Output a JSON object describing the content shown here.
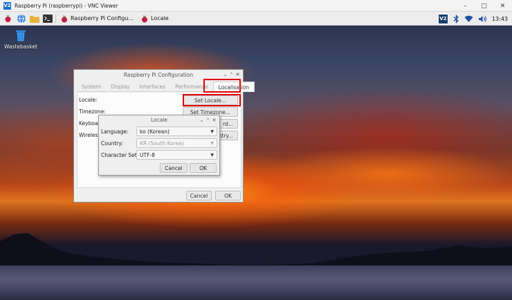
{
  "vnc": {
    "logo": "V2",
    "title": "Raspberry Pi (raspberrypi) - VNC Viewer",
    "controls": [
      "–",
      "□",
      "✕"
    ]
  },
  "taskbar": {
    "task_config": "Raspberry Pi Configu...",
    "task_locale": "Locale",
    "tray_vnc": "V2",
    "clock": "13:43"
  },
  "desktop": {
    "wastebasket_label": "Wastebasket"
  },
  "config_dialog": {
    "title": "Raspberry Pi Configuration",
    "title_controls": [
      "⌄",
      "⌃",
      "✕"
    ],
    "tabs": [
      "System",
      "Display",
      "Interfaces",
      "Performance",
      "Localisation"
    ],
    "active_tab": "Localisation",
    "rows": {
      "locale": "Locale:",
      "timezone": "Timezone:",
      "keyboard": "Keyboard",
      "wireless": "Wireless"
    },
    "buttons": {
      "set_locale": "Set Locale...",
      "set_timezone": "Set Timezone...",
      "keyboard_partial": "rd...",
      "country_partial": "ountry..."
    },
    "cancel": "Cancel",
    "ok": "OK"
  },
  "locale_dialog": {
    "title": "Locale",
    "title_controls": [
      "⌄",
      "⌃",
      "✕"
    ],
    "language_label": "Language:",
    "language_value": "ko (Korean)",
    "country_label": "Country:",
    "country_value": "KR (South Korea)",
    "charset_label": "Character Set:",
    "charset_value": "UTF-8",
    "cancel": "Cancel",
    "ok": "OK"
  },
  "colors": {
    "highlight": "#e00000",
    "vnc_blue": "#1f6fd0"
  }
}
